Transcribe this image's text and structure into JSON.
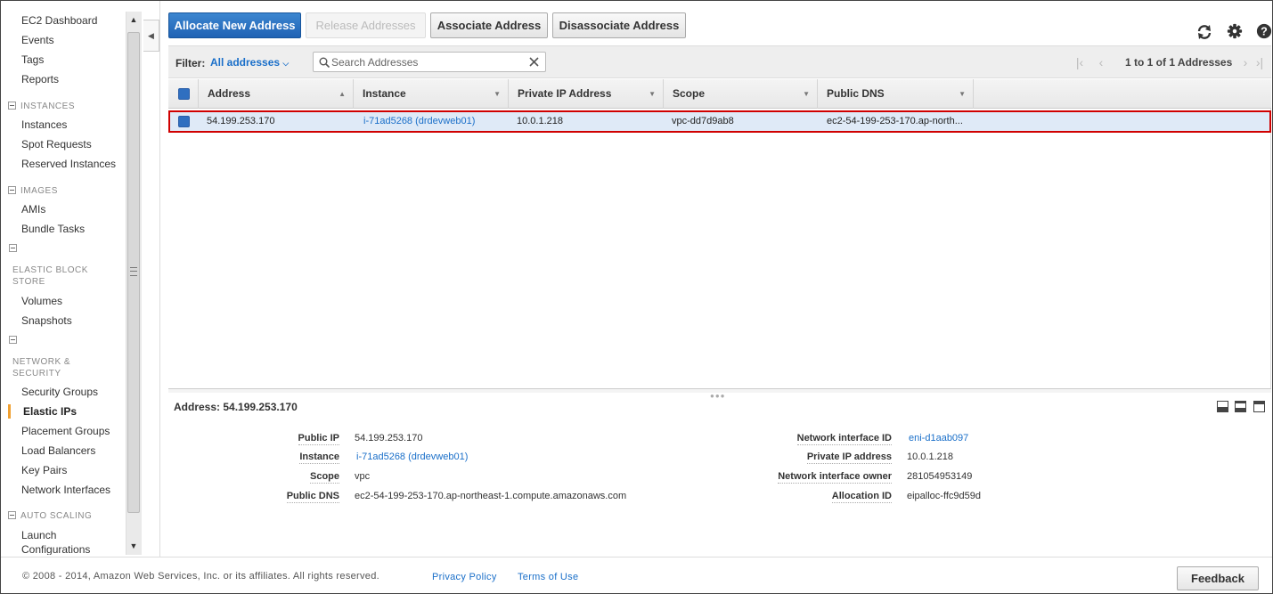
{
  "sidebar": {
    "top_items": [
      {
        "label": "EC2 Dashboard"
      },
      {
        "label": "Events"
      },
      {
        "label": "Tags"
      },
      {
        "label": "Reports"
      }
    ],
    "instances_section": "INSTANCES",
    "instances_items": [
      {
        "label": "Instances"
      },
      {
        "label": "Spot Requests"
      },
      {
        "label": "Reserved Instances"
      }
    ],
    "images_section": "IMAGES",
    "images_items": [
      {
        "label": "AMIs"
      },
      {
        "label": "Bundle Tasks"
      }
    ],
    "ebs_section": "ELASTIC BLOCK STORE",
    "ebs_items": [
      {
        "label": "Volumes"
      },
      {
        "label": "Snapshots"
      }
    ],
    "network_section": "NETWORK & SECURITY",
    "network_items": [
      {
        "label": "Security Groups"
      },
      {
        "label": "Elastic IPs",
        "active": true
      },
      {
        "label": "Placement Groups"
      },
      {
        "label": "Load Balancers"
      },
      {
        "label": "Key Pairs"
      },
      {
        "label": "Network Interfaces"
      }
    ],
    "autoscaling_section": "AUTO SCALING",
    "autoscaling_items": [
      {
        "label": "Launch Configurations"
      }
    ]
  },
  "toolbar": {
    "allocate_label": "Allocate New Address",
    "release_label": "Release Addresses",
    "associate_label": "Associate Address",
    "disassociate_label": "Disassociate Address",
    "icons": [
      "refresh-icon",
      "gear-icon",
      "help-icon"
    ]
  },
  "filter": {
    "label": "Filter:",
    "value": "All addresses",
    "search_placeholder": "Search Addresses",
    "pager_text": "1 to 1 of 1 Addresses"
  },
  "table": {
    "columns": [
      "Address",
      "Instance",
      "Private IP Address",
      "Scope",
      "Public DNS"
    ],
    "rows": [
      {
        "address": "54.199.253.170",
        "instance": "i-71ad5268 (drdevweb01)",
        "private_ip": "10.0.1.218",
        "scope": "vpc-dd7d9ab8",
        "public_dns": "ec2-54-199-253-170.ap-north..."
      }
    ]
  },
  "details": {
    "title": "Address: 54.199.253.170",
    "left": [
      {
        "label": "Public IP",
        "value": "54.199.253.170"
      },
      {
        "label": "Instance",
        "value": "i-71ad5268 (drdevweb01)"
      },
      {
        "label": "Scope",
        "value": "vpc"
      },
      {
        "label": "Public DNS",
        "value": "ec2-54-199-253-170.ap-northeast-1.compute.amazonaws.com"
      }
    ],
    "right": [
      {
        "label": "Network interface ID",
        "value": "eni-d1aab097"
      },
      {
        "label": "Private IP address",
        "value": "10.0.1.218"
      },
      {
        "label": "Network interface owner",
        "value": "281054953149"
      },
      {
        "label": "Allocation ID",
        "value": "eipalloc-ffc9d59d"
      }
    ]
  },
  "footer": {
    "copyright": "© 2008 - 2014, Amazon Web Services, Inc. or its affiliates. All rights reserved.",
    "privacy": "Privacy Policy",
    "terms": "Terms of Use",
    "feedback": "Feedback"
  },
  "colors": {
    "primary_button": "#1f62b4",
    "link": "#1a6fc9",
    "selected_row": "#dfeaf7",
    "highlight_border": "#d00000",
    "active_nav_marker": "#f0a030"
  }
}
